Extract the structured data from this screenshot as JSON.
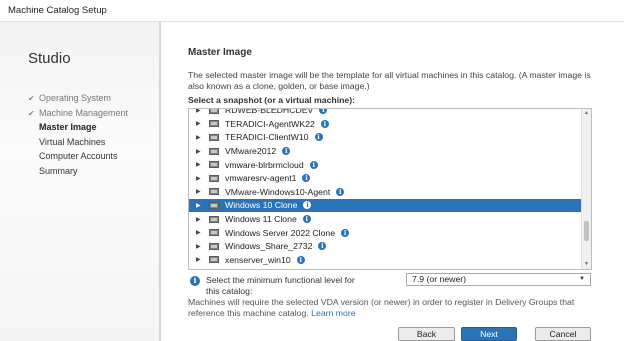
{
  "window": {
    "title": "Machine Catalog Setup"
  },
  "sidebar": {
    "app_name": "Studio",
    "steps": [
      {
        "label": "Operating System",
        "state": "done",
        "check_icon": "checkmark-icon"
      },
      {
        "label": "Machine Management",
        "state": "done",
        "check_icon": "checkmark-icon"
      },
      {
        "label": "Master Image",
        "state": "current"
      },
      {
        "label": "Virtual Machines",
        "state": "pending"
      },
      {
        "label": "Computer Accounts",
        "state": "pending"
      },
      {
        "label": "Summary",
        "state": "pending"
      }
    ]
  },
  "main": {
    "heading": "Master Image",
    "description": "The selected master image will be the template for all virtual machines in this catalog. (A master image is also known as a clone, golden, or base image.)",
    "select_label": "Select a snapshot (or a virtual machine):",
    "tree_items": [
      {
        "name": "RDWEB-BLEDHCDEV",
        "selected": false
      },
      {
        "name": "TERADICI-AgentWK22",
        "selected": false
      },
      {
        "name": "TERADICI-ClientW10",
        "selected": false
      },
      {
        "name": "VMware2012",
        "selected": false
      },
      {
        "name": "vmware-blrbrmcloud",
        "selected": false
      },
      {
        "name": "vmwaresrv-agent1",
        "selected": false
      },
      {
        "name": "VMware-Windows10-Agent",
        "selected": false
      },
      {
        "name": "Windows 10 Clone",
        "selected": true
      },
      {
        "name": "Windows 11 Clone",
        "selected": false
      },
      {
        "name": "Windows Server 2022 Clone",
        "selected": false
      },
      {
        "name": "Windows_Share_2732",
        "selected": false
      },
      {
        "name": "xenserver_win10",
        "selected": false
      }
    ],
    "functional_level": {
      "label": "Select the minimum functional level for this catalog:",
      "selected_value": "7.9 (or newer)"
    },
    "note": {
      "text": "Machines will require the selected VDA version (or newer) in order to register in Delivery Groups that reference this machine catalog.",
      "link": "Learn more"
    }
  },
  "buttons": {
    "back": "Back",
    "next": "Next",
    "cancel": "Cancel"
  },
  "colors": {
    "accent": "#2b73b8",
    "selection": "#2b73b8"
  }
}
